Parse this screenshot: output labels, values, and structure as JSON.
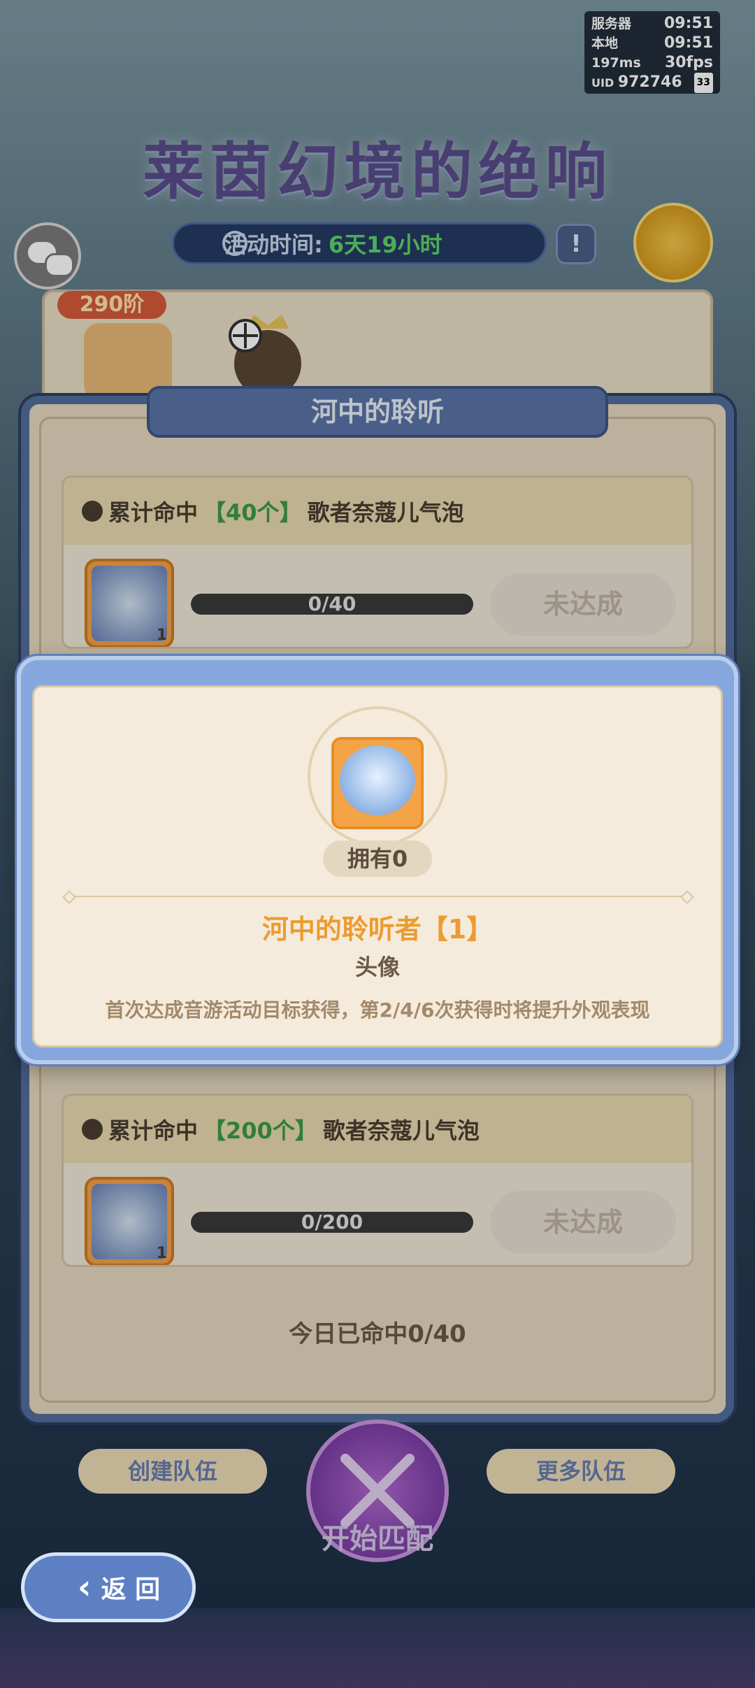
{
  "status": {
    "server_label": "服务器",
    "server_time": "09:51",
    "local_label": "本地",
    "local_time": "09:51",
    "ping": "197ms",
    "fps": "30fps",
    "uid_label": "UID",
    "uid": "972746",
    "battery": "33"
  },
  "header": {
    "title": "莱茵幻境的绝响",
    "time_label": "活动时间:",
    "time_value": "6天19小时",
    "info_glyph": "!"
  },
  "season": {
    "level": "290阶"
  },
  "panel": {
    "tab_title": "河中的聆听",
    "tasks": [
      {
        "prefix": "累计命中",
        "highlight": "【40个】",
        "suffix": "歌者奈蔻儿气泡",
        "reward_count": "1",
        "progress": "0/40",
        "progress_fraction": 0,
        "status": "未达成"
      },
      {
        "prefix": "累计命中",
        "highlight": "【200个】",
        "suffix": "歌者奈蔻儿气泡",
        "reward_count": "1",
        "progress": "0/200",
        "progress_fraction": 0,
        "status": "未达成"
      }
    ],
    "today": "今日已命中0/40"
  },
  "popup": {
    "owned": "拥有0",
    "item_name": "河中的聆听者【1】",
    "item_type": "头像",
    "description": "首次达成音游活动目标获得，第2/4/6次获得时将提升外观表现"
  },
  "bottom": {
    "create_team": "创建队伍",
    "more_teams": "更多队伍",
    "start_match": "开始匹配",
    "back": "返 回",
    "back_glyph": "‹"
  },
  "colors": {
    "accent_orange": "#ec9b2f",
    "green": "#3e9a46",
    "panel_blue": "#536d9c"
  }
}
